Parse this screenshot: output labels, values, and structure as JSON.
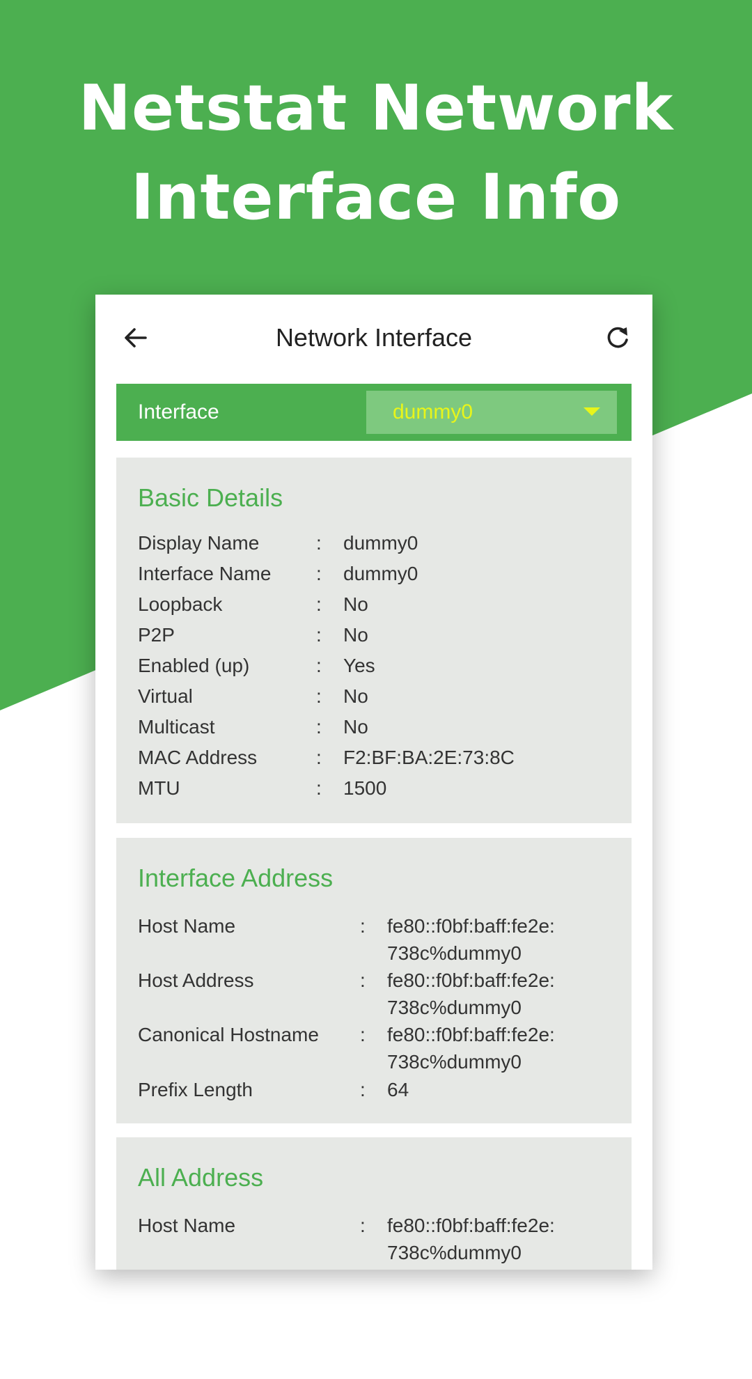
{
  "promo": {
    "title_line1": "Netstat Network",
    "title_line2": "Interface Info"
  },
  "colors": {
    "brand_green": "#4caf50",
    "dropdown_green": "#7ec97f",
    "dropdown_text": "#e8f51a",
    "card_bg": "#e6e8e5"
  },
  "appbar": {
    "title": "Network Interface",
    "back_icon": "arrow-left-icon",
    "refresh_icon": "refresh-icon"
  },
  "selector": {
    "label": "Interface",
    "value": "dummy0"
  },
  "basic_details": {
    "heading": "Basic Details",
    "rows": [
      {
        "label": "Display Name",
        "value": "dummy0"
      },
      {
        "label": "Interface Name",
        "value": "dummy0"
      },
      {
        "label": "Loopback",
        "value": "No"
      },
      {
        "label": "P2P",
        "value": "No"
      },
      {
        "label": "Enabled (up)",
        "value": "Yes"
      },
      {
        "label": "Virtual",
        "value": "No"
      },
      {
        "label": "Multicast",
        "value": "No"
      },
      {
        "label": "MAC Address",
        "value": "F2:BF:BA:2E:73:8C"
      },
      {
        "label": "MTU",
        "value": "1500"
      }
    ]
  },
  "interface_address": {
    "heading": "Interface Address",
    "rows": [
      {
        "label": "Host Name",
        "value_line1": "fe80::f0bf:baff:fe2e:",
        "value_line2": "738c%dummy0"
      },
      {
        "label": "Host Address",
        "value_line1": "fe80::f0bf:baff:fe2e:",
        "value_line2": "738c%dummy0"
      },
      {
        "label": "Canonical Hostname",
        "value_line1": "fe80::f0bf:baff:fe2e:",
        "value_line2": "738c%dummy0"
      },
      {
        "label": "Prefix Length",
        "value_line1": "64",
        "value_line2": ""
      }
    ]
  },
  "all_address": {
    "heading": "All Address",
    "rows": [
      {
        "label": "Host Name",
        "value_line1": "fe80::f0bf:baff:fe2e:",
        "value_line2": "738c%dummy0"
      }
    ]
  },
  "separator": ":"
}
